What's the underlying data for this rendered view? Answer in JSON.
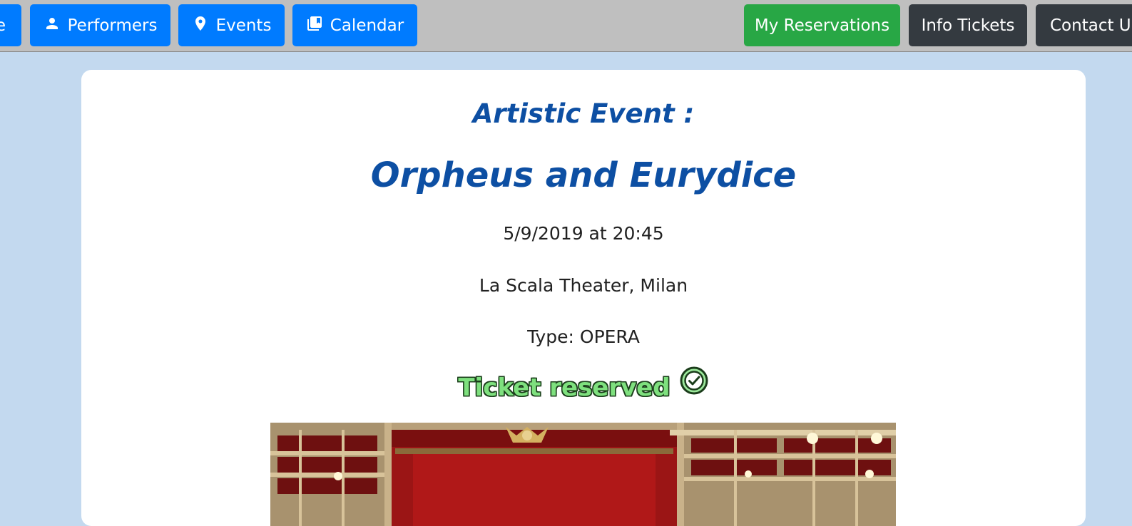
{
  "nav": {
    "home_label": "e",
    "performers_label": "Performers",
    "events_label": "Events",
    "calendar_label": "Calendar",
    "reservations_label": "My Reservations",
    "info_label": "Info Tickets",
    "contact_label": "Contact U"
  },
  "event": {
    "section_label": "Artistic Event :",
    "title": "Orpheus and Eurydice",
    "datetime": "5/9/2019 at 20:45",
    "venue": "La Scala Theater, Milan",
    "type_text": "Type: OPERA",
    "reservation_status": "Ticket reserved"
  },
  "icons": {
    "performers": "person-icon",
    "events": "map-pin-icon",
    "calendar": "library-books-icon",
    "reserved": "check-circle-icon"
  },
  "colors": {
    "navbar_bg": "#bfbfbf",
    "primary_button": "#007bff",
    "success_button": "#28a745",
    "dark_button": "#343a40",
    "page_bg": "#c3d9ef",
    "heading": "#0d4fa3",
    "reserved_text": "#7ee07e"
  }
}
